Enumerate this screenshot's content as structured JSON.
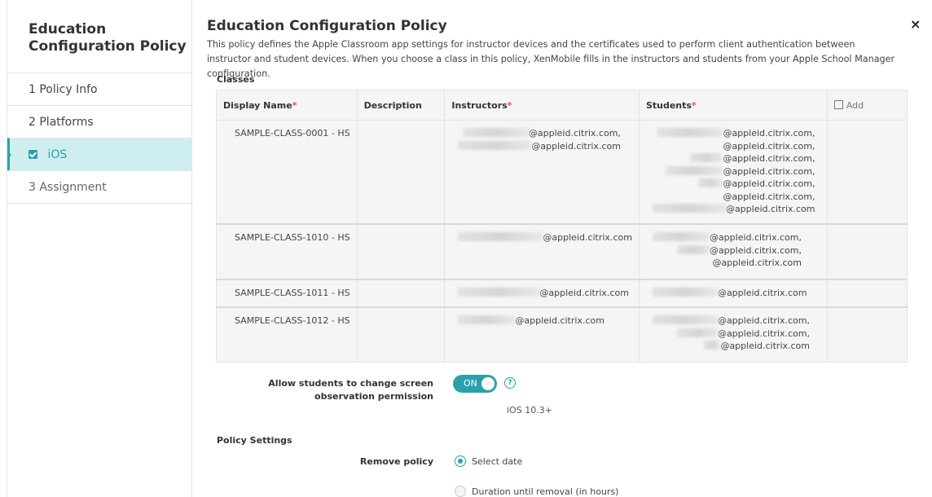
{
  "sidebar": {
    "title": "Education Configuration Policy",
    "items": [
      {
        "label": "1 Policy Info"
      },
      {
        "label": "2 Platforms"
      },
      {
        "label": "iOS"
      },
      {
        "label": "3 Assignment"
      }
    ]
  },
  "main": {
    "title": "Education Configuration Policy",
    "description": "This policy defines the Apple Classroom app settings for instructor devices and the certificates used to perform client authentication between instructor and student devices. When you choose a class in this policy, XenMobile fills in the instructors and students from your Apple School Manager configuration.",
    "close_icon": "×",
    "classes_label": "Classes",
    "table": {
      "headers": {
        "display_name": "Display Name",
        "description": "Description",
        "instructors": "Instructors",
        "students": "Students",
        "add": "Add",
        "required_mark": "*"
      },
      "rows": [
        {
          "display_name": "SAMPLE-CLASS-0001 - HS",
          "description": "",
          "instructors": [
            "@appleid.citrix.com,",
            "@appleid.citrix.com"
          ],
          "students": [
            "@appleid.citrix.com,",
            "@appleid.citrix.com,",
            "@appleid.citrix.com,",
            "@appleid.citrix.com,",
            "@appleid.citrix.com,",
            "@appleid.citrix.com,",
            "@appleid.citrix.com"
          ]
        },
        {
          "display_name": "SAMPLE-CLASS-1010 - HS",
          "description": "",
          "instructors": [
            "@appleid.citrix.com"
          ],
          "students": [
            "@appleid.citrix.com,",
            "@appleid.citrix.com,",
            "@appleid.citrix.com"
          ]
        },
        {
          "display_name": "SAMPLE-CLASS-1011 - HS",
          "description": "",
          "instructors": [
            "@appleid.citrix.com"
          ],
          "students": [
            "@appleid.citrix.com"
          ]
        },
        {
          "display_name": "SAMPLE-CLASS-1012 - HS",
          "description": "",
          "instructors": [
            "@appleid.citrix.com"
          ],
          "students": [
            "@appleid.citrix.com,",
            "@appleid.citrix.com,",
            "@appleid.citrix.com"
          ]
        }
      ]
    },
    "observation": {
      "label": "Allow students to change screen observation permission",
      "toggle": "ON",
      "help": "?",
      "ios_version": "iOS 10.3+"
    },
    "policy_settings": {
      "heading": "Policy Settings",
      "remove_label": "Remove policy",
      "options": [
        "Select date",
        "Duration until removal (in hours)"
      ],
      "selected": "Select date"
    }
  },
  "colors": {
    "accent": "#2aa1aa",
    "required": "#d9534f",
    "selected_bg": "#cfeef0"
  }
}
